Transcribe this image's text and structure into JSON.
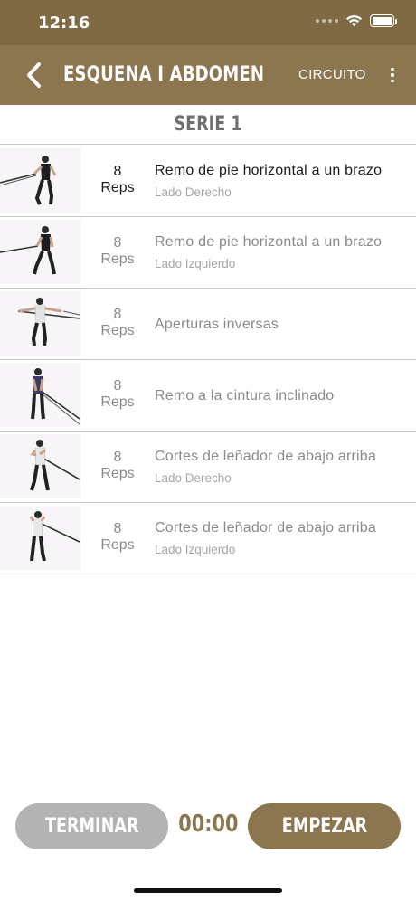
{
  "status_bar": {
    "time": "12:16",
    "icons": [
      "cellular-signal-icon",
      "wifi-icon",
      "battery-icon"
    ]
  },
  "nav": {
    "title": "ESQUENA I ABDOMEN",
    "back_icon": "chevron-left-icon",
    "circuit_label": "CIRCUITO",
    "more_icon": "more-vertical-icon"
  },
  "serie": {
    "label": "SERIE 1"
  },
  "exercises": [
    {
      "reps": "8",
      "reps_unit": "Reps",
      "name": "Remo de pie horizontal a un brazo",
      "side": "Lado Derecho",
      "active": true
    },
    {
      "reps": "8",
      "reps_unit": "Reps",
      "name": "Remo de pie horizontal a un brazo",
      "side": "Lado Izquierdo",
      "active": false
    },
    {
      "reps": "8",
      "reps_unit": "Reps",
      "name": "Aperturas inversas",
      "side": "",
      "active": false
    },
    {
      "reps": "8",
      "reps_unit": "Reps",
      "name": "Remo a la cintura inclinado",
      "side": "",
      "active": false
    },
    {
      "reps": "8",
      "reps_unit": "Reps",
      "name": "Cortes de leñador de abajo arriba",
      "side": "Lado Derecho",
      "active": false
    },
    {
      "reps": "8",
      "reps_unit": "Reps",
      "name": "Cortes de leñador de abajo arriba",
      "side": "Lado Izquierdo",
      "active": false
    }
  ],
  "controls": {
    "finish_label": "TERMINAR",
    "timer": "00:00",
    "start_label": "EMPEZAR"
  },
  "colors": {
    "brand": "#8c7650",
    "status_bar": "#7f6a43",
    "disabled_button": "#b3b3b3",
    "active_text": "#1c1c1c",
    "inactive_text": "#8a8a8a"
  }
}
